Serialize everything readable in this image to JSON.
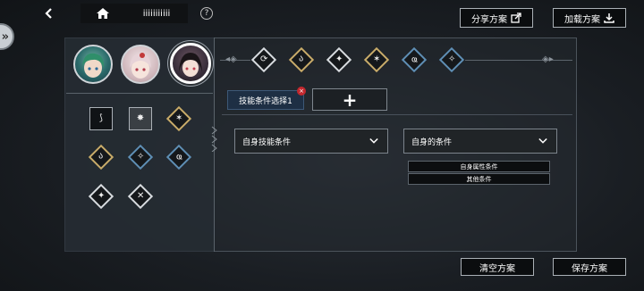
{
  "topbar": {
    "title": "iiiiiiiiiii",
    "help": "?",
    "share_label": "分享方案",
    "load_label": "加载方案"
  },
  "characters": [
    {
      "name": "avatar-green-hair",
      "bg": "#2a6a6a"
    },
    {
      "name": "avatar-pink-hair",
      "bg": "#d7c2c6"
    },
    {
      "name": "avatar-dark-hair",
      "bg": "#3a2f3c",
      "selected": true
    }
  ],
  "skills_grid": [
    {
      "icon": "scythe-icon",
      "glyph": "⟆",
      "style": "square"
    },
    {
      "icon": "mask-icon",
      "glyph": "✸",
      "style": "square dark"
    },
    {
      "icon": "burst-icon",
      "glyph": "✶",
      "style": "gold"
    },
    {
      "icon": "swirl-icon",
      "glyph": "ა",
      "style": "gold"
    },
    {
      "icon": "strike-icon",
      "glyph": "✧",
      "style": "blue"
    },
    {
      "icon": "wave-icon",
      "glyph": "ҩ",
      "style": "blue"
    },
    {
      "icon": "flame-icon",
      "glyph": "✦",
      "style": "white"
    },
    {
      "icon": "blade-icon",
      "glyph": "✕",
      "style": "white"
    }
  ],
  "header_skills": [
    {
      "icon": "ring-icon",
      "glyph": "⟳",
      "style": "white"
    },
    {
      "icon": "swirl-icon",
      "glyph": "ა",
      "style": "gold"
    },
    {
      "icon": "flame-icon",
      "glyph": "✦",
      "style": "white"
    },
    {
      "icon": "burst-icon",
      "glyph": "✶",
      "style": "gold"
    },
    {
      "icon": "wave-icon",
      "glyph": "ҩ",
      "style": "blue"
    },
    {
      "icon": "strike-icon",
      "glyph": "✧",
      "style": "blue"
    }
  ],
  "condition_tab": {
    "label": "技能条件选择1",
    "close": "×",
    "add": "+"
  },
  "dropdowns": {
    "left": "自身技能条件",
    "right": "自身的条件"
  },
  "options": [
    "自身属性条件",
    "其他条件"
  ],
  "bottom": {
    "clear_label": "清空方案",
    "save_label": "保存方案"
  },
  "colors": {
    "gold": "#c9ac6a",
    "blue": "#5f8fb5",
    "tab_bg": "#1e2f44",
    "close_red": "#c3282e"
  }
}
